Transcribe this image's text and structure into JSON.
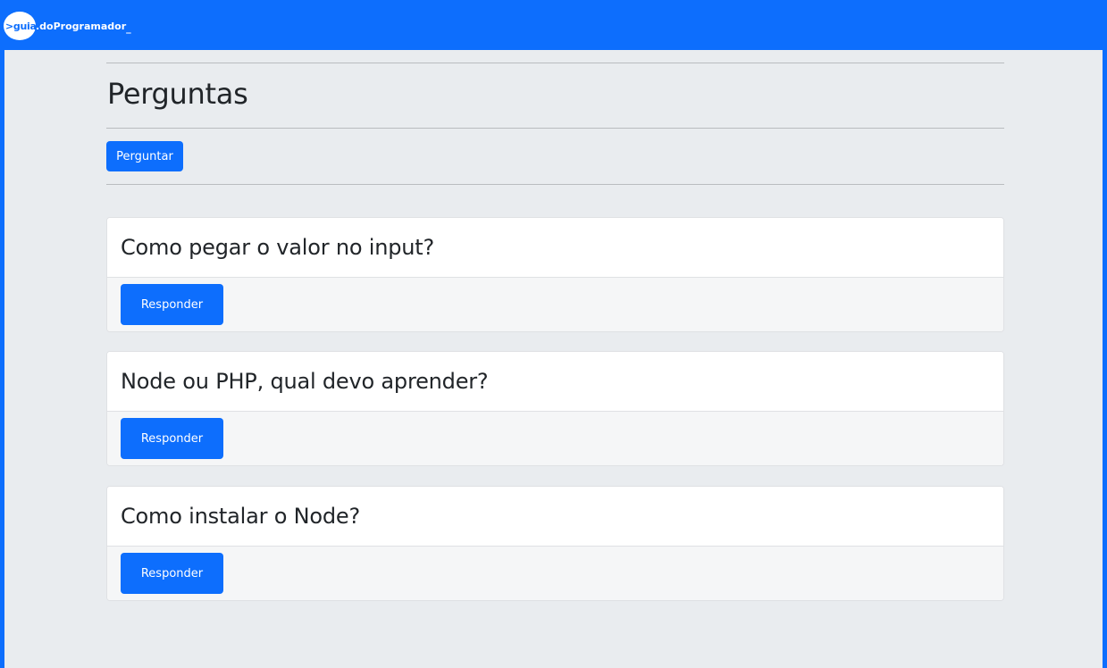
{
  "navbar": {
    "logo_prefix": ">guia",
    "logo_suffix": ".doProgramador",
    "logo_cursor": "_"
  },
  "main": {
    "title": "Perguntas",
    "ask_button_label": "Perguntar",
    "questions": [
      {
        "title": "Como pegar o valor no input?",
        "answer_button_label": "Responder"
      },
      {
        "title": "Node ou PHP, qual devo aprender?",
        "answer_button_label": "Responder"
      },
      {
        "title": "Como instalar o Node?",
        "answer_button_label": "Responder"
      }
    ]
  },
  "colors": {
    "primary": "#0d6efd",
    "page_background": "#e9ecef",
    "card_footer": "#f5f6f7",
    "text": "#212529"
  }
}
